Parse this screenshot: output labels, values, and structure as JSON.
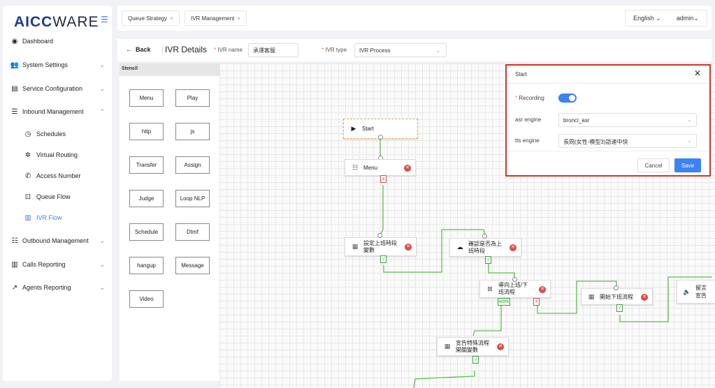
{
  "sidebar": {
    "logo_part1": "AICC",
    "logo_part2": "WARE",
    "items": [
      {
        "label": "Dashboard",
        "icon": "dashboard-icon"
      },
      {
        "label": "System Settings",
        "icon": "users-icon"
      },
      {
        "label": "Service Configuration",
        "icon": "card-icon"
      },
      {
        "label": "Inbound Management",
        "icon": "list-icon"
      },
      {
        "label": "Outbound Management",
        "icon": "table-icon"
      },
      {
        "label": "Calls Reporting",
        "icon": "bar-chart-icon"
      },
      {
        "label": "Agents Reporting",
        "icon": "line-chart-icon"
      }
    ],
    "subitems": [
      {
        "label": "Schedules",
        "icon": "clock-icon"
      },
      {
        "label": "Virtual Routing",
        "icon": "gear-icon"
      },
      {
        "label": "Access Number",
        "icon": "phone-icon"
      },
      {
        "label": "Queue Flow",
        "icon": "queue-icon"
      },
      {
        "label": "IVR Flow",
        "icon": "ivr-icon",
        "active": true
      }
    ]
  },
  "topbar": {
    "tabs": [
      {
        "label": "Queue Strategy"
      },
      {
        "label": "IVR Management"
      }
    ],
    "language": "English",
    "user": "admin"
  },
  "toolbar": {
    "back_label": "Back",
    "title": "IVR Details",
    "ivr_name_label": "IVR name",
    "ivr_name_value": "承運客服",
    "ivr_type_label": "IVR type",
    "ivr_type_value": "IVR Process"
  },
  "stencil": {
    "header": "Stencil",
    "buttons": [
      "Menu",
      "Play",
      "http",
      "js",
      "Transfer",
      "Assign",
      "Judge",
      "Loop NLP",
      "Schedule",
      "Dtmf",
      "hangup",
      "Message",
      "Video"
    ]
  },
  "flow": {
    "nodes": {
      "start": "Start",
      "menu": "Menu",
      "set_var_1": "設定上班時段",
      "set_var_2": "變數",
      "check_1": "確認是否為上",
      "check_2": "班時段",
      "guide_1": "導向上班/下",
      "guide_2": "班流程",
      "begin_off": "開始下班流程",
      "msg_1": "留言",
      "msg_2": "宣告",
      "announce_1": "宣告特殊流程",
      "announce_2": "開關變數"
    },
    "ports": {
      "x": "x",
      "ok": "√",
      "work": "work"
    }
  },
  "dialog": {
    "title": "Start",
    "recording_label": "Recording",
    "recording_on": true,
    "asr_label": "asr engine",
    "asr_value": "bronci_asr",
    "tts_label": "tts engine",
    "tts_value": "長問(女性-模型3)語速中快",
    "cancel_label": "Cancel",
    "save_label": "Save",
    "accent": "#3b82f6",
    "highlight_border": "#d9302c"
  }
}
